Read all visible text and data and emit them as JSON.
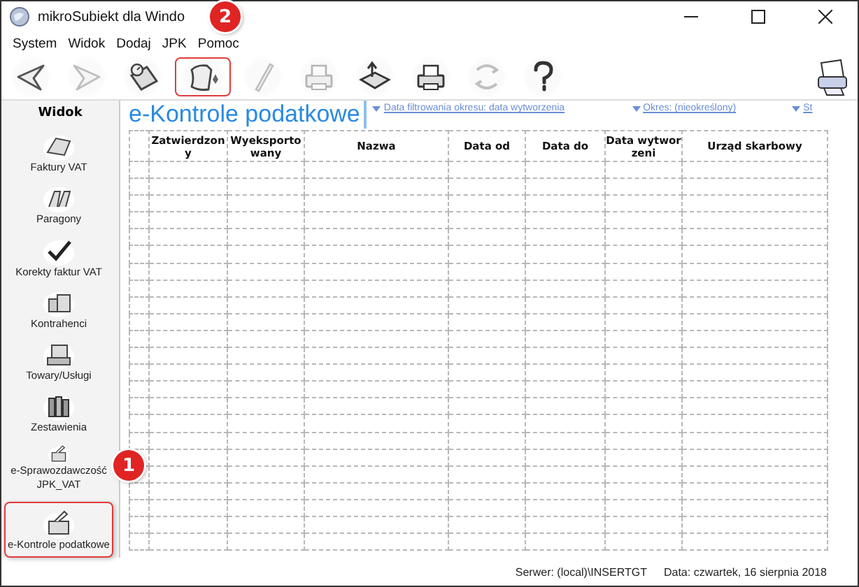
{
  "window": {
    "title": "mikroSubiekt dla Windo"
  },
  "menu": [
    "System",
    "Widok",
    "Dodaj",
    "JPK",
    "Pomoc"
  ],
  "toolbar": [
    {
      "kind": "back",
      "disabled": false,
      "highlighted": false
    },
    {
      "kind": "forward",
      "disabled": true,
      "highlighted": false
    },
    {
      "kind": "tools",
      "disabled": false,
      "highlighted": false
    },
    {
      "kind": "new-document",
      "disabled": false,
      "highlighted": true
    },
    {
      "kind": "edit",
      "disabled": true,
      "highlighted": false
    },
    {
      "kind": "print",
      "disabled": true,
      "highlighted": false
    },
    {
      "kind": "export",
      "disabled": false,
      "highlighted": false
    },
    {
      "kind": "print",
      "disabled": false,
      "highlighted": false
    },
    {
      "kind": "refresh",
      "disabled": true,
      "highlighted": false
    },
    {
      "kind": "help",
      "disabled": false,
      "highlighted": false
    }
  ],
  "sidebar": {
    "heading": "Widok",
    "items": [
      {
        "label": "Faktury VAT",
        "highlighted": false
      },
      {
        "label": "Paragony",
        "highlighted": false
      },
      {
        "label": "Korekty faktur VAT",
        "highlighted": false
      },
      {
        "label": "Kontrahenci",
        "highlighted": false
      },
      {
        "label": "Towary/Usługi",
        "highlighted": false
      },
      {
        "label": "Zestawienia",
        "highlighted": false
      },
      {
        "label": "e-Sprawozdawczość JPK_VAT",
        "highlighted": false
      },
      {
        "label": "e-Kontrole podatkowe",
        "highlighted": true
      }
    ]
  },
  "callouts": [
    "1",
    "2"
  ],
  "view": {
    "title": "e-Kontrole podatkowe",
    "filters": [
      "Data filtrowania okresu: data wytworzenia",
      "Okres: (nieokreślony)",
      "St"
    ]
  },
  "table": {
    "columns": [
      "Zatwierdzony",
      "Wyeksportowany",
      "Nazwa",
      "Data od",
      "Data do",
      "Data wytworzeni",
      "Urząd skarbowy"
    ]
  },
  "status_bar": {
    "server": "Serwer: (local)\\INSERTGT",
    "date": "Data: czwartek, 16 sierpnia 2018"
  }
}
